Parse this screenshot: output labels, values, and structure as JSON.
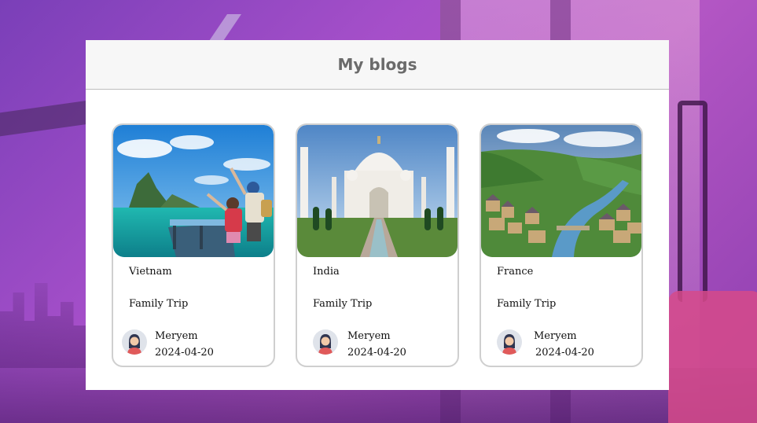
{
  "page": {
    "title": "My blogs"
  },
  "colors": {
    "accent": "#b356c4",
    "card_border": "#cfcfcf",
    "title_text": "#6b6b6b"
  },
  "blogs": [
    {
      "country": "Vietnam",
      "category": "Family Trip",
      "author": "Meryem",
      "date": "2024-04-20",
      "image": "vietnam-bay-photo",
      "avatar": "user-avatar-icon"
    },
    {
      "country": "India",
      "category": "Family Trip",
      "author": "Meryem",
      "date": "2024-04-20",
      "image": "taj-mahal-photo",
      "avatar": "user-avatar-icon"
    },
    {
      "country": "France",
      "category": "Family Trip",
      "author": "Meryem",
      "date": "2024-04-20",
      "image": "french-town-river-photo",
      "avatar": "user-avatar-icon"
    }
  ]
}
